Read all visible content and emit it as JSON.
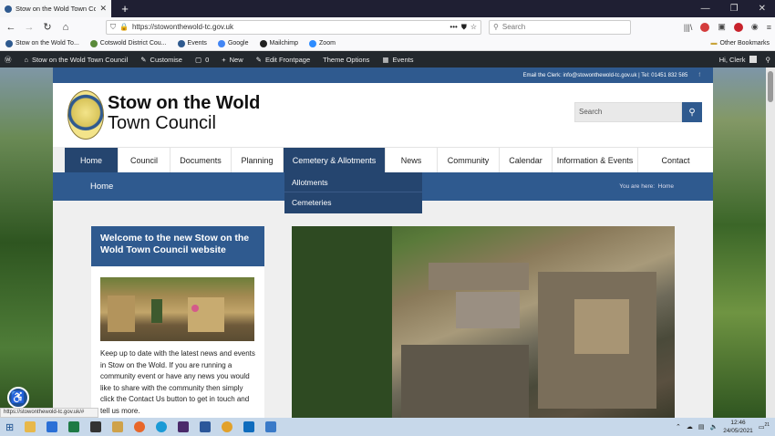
{
  "browser": {
    "tab_title": "Stow on the Wold Town Counc",
    "url": "https://stowonthewold-tc.gov.uk",
    "search_placeholder": "Search",
    "bookmarks": [
      "Stow on the Wold To...",
      "Cotswold District Cou...",
      "Events",
      "Google",
      "Mailchimp",
      "Zoom"
    ],
    "other_bookmarks": "Other Bookmarks",
    "status_url": "https://stowonthewold-tc.gov.uk/#"
  },
  "wp_admin": {
    "site": "Stow on the Wold Town Council",
    "customise": "Customise",
    "comments": "0",
    "new": "New",
    "edit": "Edit Frontpage",
    "theme": "Theme Options",
    "events": "Events",
    "greeting": "Hi, Clerk"
  },
  "site": {
    "contact": "Email the Clerk: info@stowonthewold-tc.gov.uk | Tel: 01451 832 585",
    "name_line1": "Stow on the Wold",
    "name_line2": "Town Council",
    "search_placeholder": "Search",
    "menu": [
      "Home",
      "Council",
      "Documents",
      "Planning",
      "Cemetery & Allotments",
      "News",
      "Community",
      "Calendar",
      "Information & Events",
      "Contact"
    ],
    "dropdown": [
      "Allotments",
      "Cemeteries"
    ],
    "page_heading": "Home",
    "you_are_here": "You are here:",
    "crumb": "Home",
    "welcome_title": "Welcome to the new Stow on the Wold Town Council website",
    "welcome_text": "Keep up to date with the latest news and events in Stow on the Wold. If you are running a community event or have any news you would like to share with the community then simply click the Contact Us button to get in touch and tell us more."
  },
  "taskbar": {
    "time": "12:46",
    "date": "24/05/2021",
    "notifications": "21"
  },
  "colors": {
    "brand_blue": "#2f5a8f",
    "nav_active": "#25456f"
  }
}
